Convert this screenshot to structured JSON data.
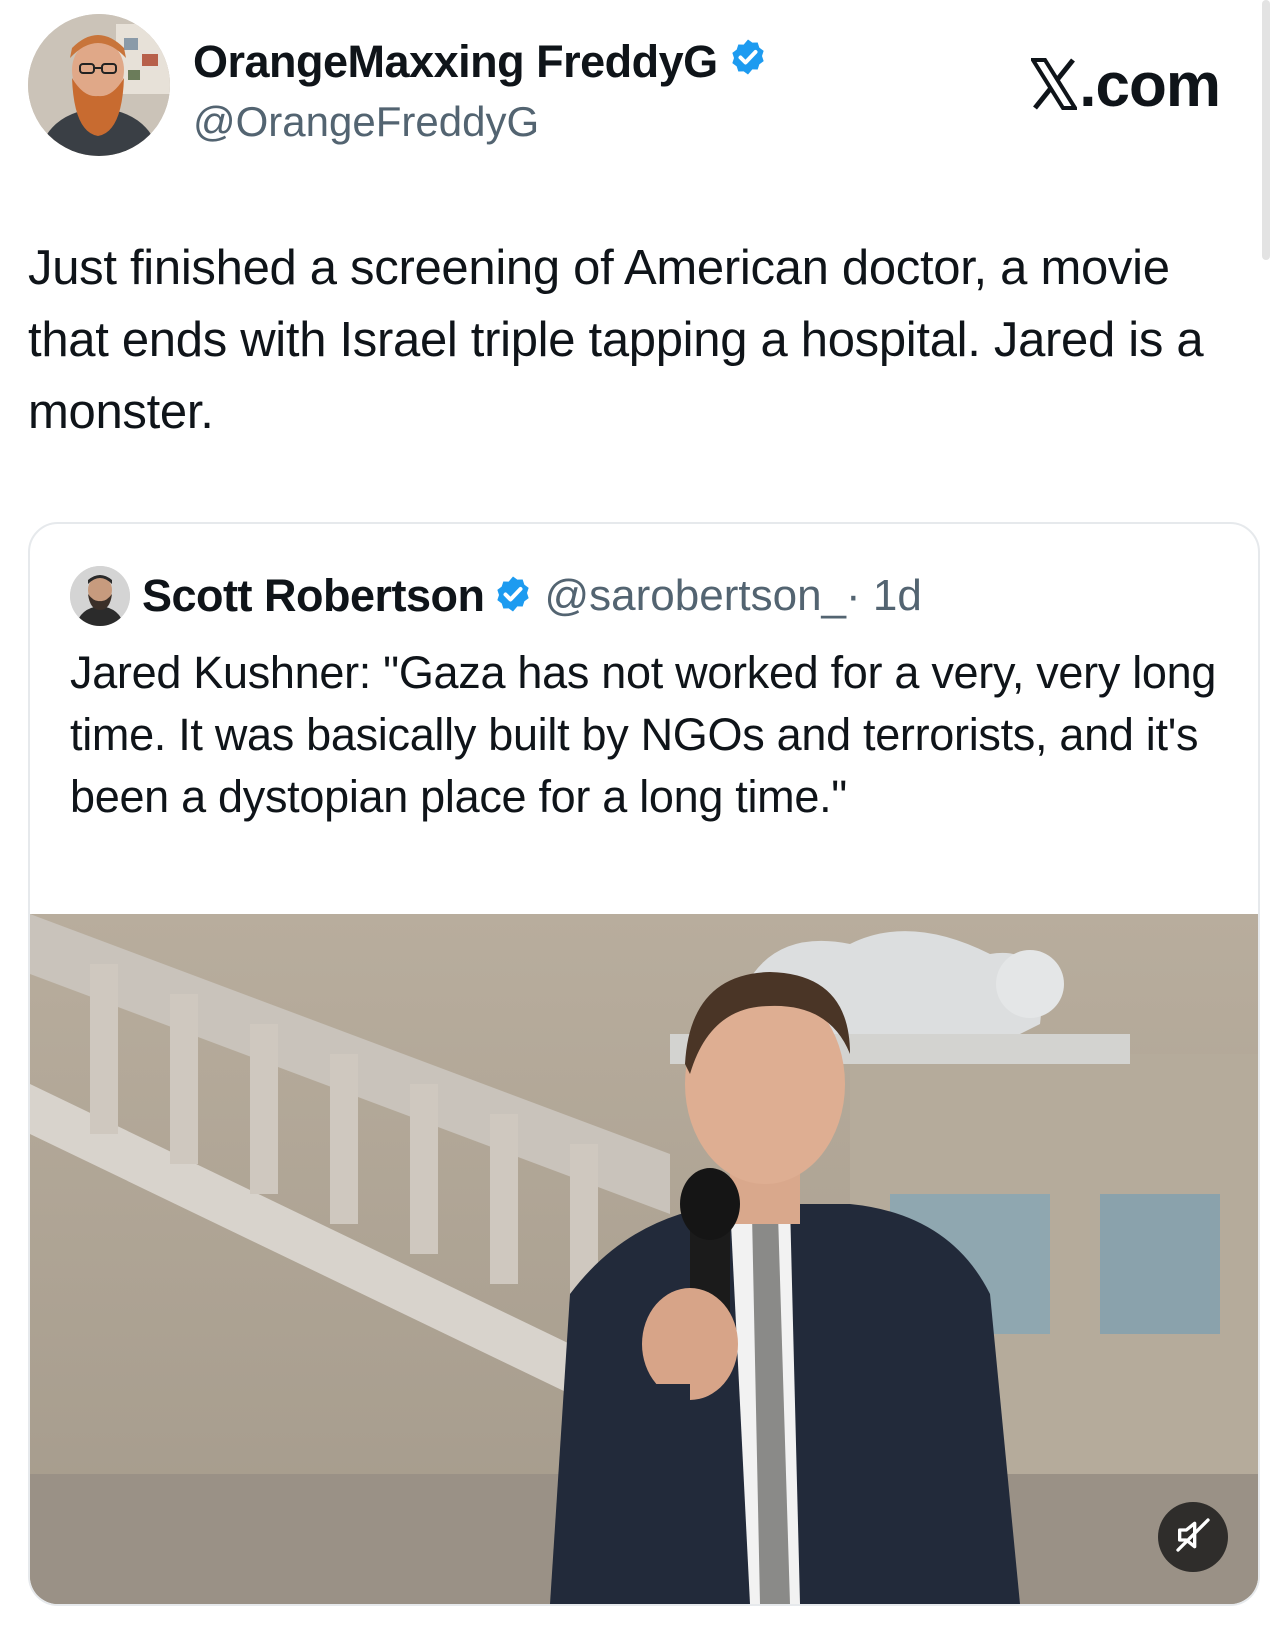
{
  "post": {
    "author_name": "OrangeMaxxing FreddyG",
    "author_handle": "@OrangeFreddyG",
    "brand": ".com",
    "brand_icon": "x-logo-icon",
    "text": "Just finished a screening of American doctor, a movie that ends with Israel triple tapping a hospital. Jared is a monster.",
    "verified_icon": "verified-badge-icon"
  },
  "quote": {
    "author_name": "Scott Robertson",
    "author_handle": "@sarobertson_",
    "time": "· 1d",
    "text": "Jared Kushner: \"Gaza has not worked for a very, very long time. It was basically built by NGOs and terrorists, and it's been a dystopian place for a long time.\"",
    "media": {
      "kind": "video",
      "mute_icon": "muted-speaker-icon"
    }
  },
  "colors": {
    "text": "#0f1419",
    "secondary": "#536471",
    "verified": "#1d9bf0",
    "card_border": "#e6e9ec"
  }
}
